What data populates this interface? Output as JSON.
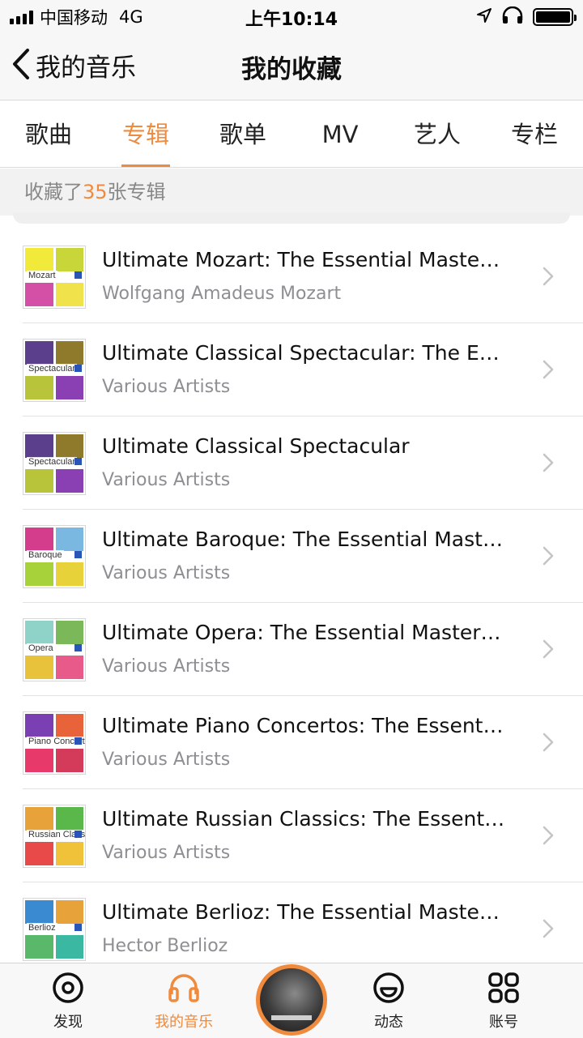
{
  "status_bar": {
    "carrier": "中国移动",
    "network": "4G",
    "time": "上午10:14"
  },
  "nav": {
    "back_label": "我的音乐",
    "title": "我的收藏"
  },
  "tabs": [
    {
      "label": "歌曲",
      "active": false
    },
    {
      "label": "专辑",
      "active": true
    },
    {
      "label": "歌单",
      "active": false
    },
    {
      "label": "MV",
      "active": false
    },
    {
      "label": "艺人",
      "active": false
    },
    {
      "label": "专栏",
      "active": false
    }
  ],
  "count": {
    "prefix": "收藏了",
    "number": "35",
    "suffix": "张专辑"
  },
  "albums": [
    {
      "title": "Ultimate Mozart: The Essential Masterpieces",
      "artist": "Wolfgang Amadeus Mozart",
      "cover_text": "Mozart",
      "cover_colors": [
        "#f2ea3a",
        "#c9d63a",
        "#d44fa6",
        "#efe24a"
      ]
    },
    {
      "title": "Ultimate Classical Spectacular: The Essential Masterpieces",
      "artist": "Various Artists",
      "cover_text": "Spectacular",
      "cover_colors": [
        "#5b3f8c",
        "#8e7a2a",
        "#b8c43a",
        "#8a3fb2"
      ]
    },
    {
      "title": "Ultimate Classical Spectacular",
      "artist": "Various Artists",
      "cover_text": "Spectacular",
      "cover_colors": [
        "#5b3f8c",
        "#8e7a2a",
        "#b8c43a",
        "#8a3fb2"
      ]
    },
    {
      "title": "Ultimate Baroque: The Essential Masterpieces",
      "artist": "Various Artists",
      "cover_text": "Baroque",
      "cover_colors": [
        "#d43c8c",
        "#7ab8e2",
        "#a8d23a",
        "#e8d23a"
      ]
    },
    {
      "title": "Ultimate Opera: The Essential Masterpieces",
      "artist": "Various Artists",
      "cover_text": "Opera",
      "cover_colors": [
        "#8ed2c8",
        "#7ab85a",
        "#e8c23a",
        "#e85a8a"
      ]
    },
    {
      "title": "Ultimate Piano Concertos: The Essential Masterpieces",
      "artist": "Various Artists",
      "cover_text": "Piano Concertos",
      "cover_colors": [
        "#7a3fb2",
        "#e8623a",
        "#e83a6a",
        "#d43a5a"
      ]
    },
    {
      "title": "Ultimate Russian Classics: The Essential Masterpieces",
      "artist": "Various Artists",
      "cover_text": "Russian Classics",
      "cover_colors": [
        "#e8a23a",
        "#5ab84a",
        "#e84a4a",
        "#f0c23a"
      ]
    },
    {
      "title": "Ultimate Berlioz: The Essential Masterpieces",
      "artist": "Hector Berlioz",
      "cover_text": "Berlioz",
      "cover_colors": [
        "#3a8ad2",
        "#e8a23a",
        "#5ab86a",
        "#3ab8a2"
      ]
    }
  ],
  "tabbar": {
    "discover": "发现",
    "my_music": "我的音乐",
    "feed": "动态",
    "account": "账号"
  },
  "colors": {
    "accent": "#f08a3c",
    "secondary_text": "#8e8e93"
  }
}
